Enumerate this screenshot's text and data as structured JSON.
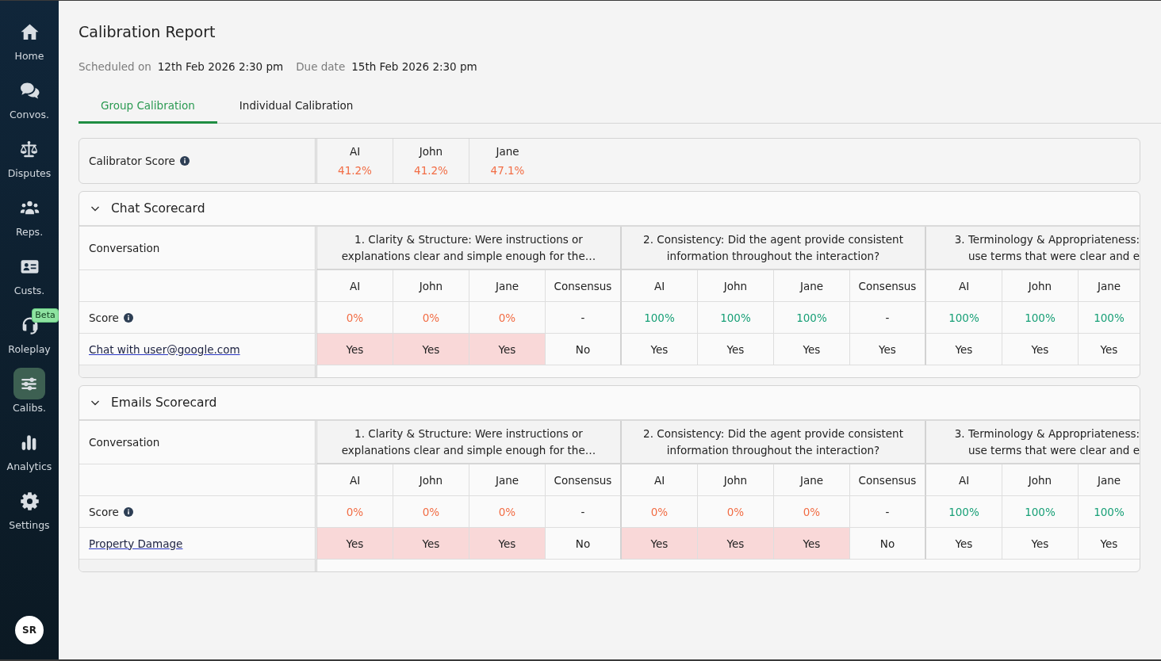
{
  "sidebar": {
    "items": [
      {
        "label": "Home",
        "selected": false
      },
      {
        "label": "Convos.",
        "selected": false
      },
      {
        "label": "Disputes",
        "selected": false
      },
      {
        "label": "Reps.",
        "selected": false
      },
      {
        "label": "Custs.",
        "selected": false
      },
      {
        "label": "Roleplay",
        "selected": false,
        "badge": "Beta"
      },
      {
        "label": "Calibs.",
        "selected": true
      },
      {
        "label": "Analytics",
        "selected": false
      },
      {
        "label": "Settings",
        "selected": false
      }
    ],
    "avatar": "SR"
  },
  "header": {
    "title": "Calibration Report",
    "meta": [
      {
        "label": "Scheduled on",
        "value": "12th Feb 2026 2:30 pm"
      },
      {
        "label": "Due date",
        "value": "15th Feb 2026 2:30 pm"
      }
    ]
  },
  "tabs": [
    {
      "label": "Group Calibration",
      "selected": true
    },
    {
      "label": "Individual Calibration",
      "selected": false
    }
  ],
  "calibrator_score": {
    "label": "Calibrator Score",
    "calibrators": [
      {
        "name": "AI",
        "score": "41.2%",
        "color": "#f26d45"
      },
      {
        "name": "John",
        "score": "41.2%",
        "color": "#f26d45"
      },
      {
        "name": "Jane",
        "score": "47.1%",
        "color": "#f26d45"
      }
    ]
  },
  "scorecards": [
    {
      "title": "Chat Scorecard",
      "expanded": true,
      "row_header": "Conversation",
      "score_label": "Score",
      "conversation": "Chat with user@google.com",
      "questions": [
        {
          "lines": [
            "1. Clarity & Structure: Were instructions or",
            "explanations clear and simple enough for the…"
          ],
          "columns": [
            {
              "name": "AI",
              "score": "0%",
              "color": "#f26d45",
              "answer": "Yes",
              "highlighted": true
            },
            {
              "name": "John",
              "score": "0%",
              "color": "#f26d45",
              "answer": "Yes",
              "highlighted": true
            },
            {
              "name": "Jane",
              "score": "0%",
              "color": "#f26d45",
              "answer": "Yes",
              "highlighted": true
            },
            {
              "name": "Consensus",
              "score": "-",
              "answer": "No",
              "highlighted": false
            }
          ]
        },
        {
          "lines": [
            "2. Consistency: Did the agent provide consistent",
            "information throughout the interaction?"
          ],
          "columns": [
            {
              "name": "AI",
              "score": "100%",
              "color": "#18a077",
              "answer": "Yes",
              "highlighted": false
            },
            {
              "name": "John",
              "score": "100%",
              "color": "#18a077",
              "answer": "Yes",
              "highlighted": false
            },
            {
              "name": "Jane",
              "score": "100%",
              "color": "#18a077",
              "answer": "Yes",
              "highlighted": false
            },
            {
              "name": "Consensus",
              "score": "-",
              "answer": "Yes",
              "highlighted": false
            }
          ]
        },
        {
          "lines": [
            "3. Terminology & Appropriateness:",
            "use terms that were clear and e"
          ],
          "columns": [
            {
              "name": "AI",
              "score": "100%",
              "color": "#18a077",
              "answer": "Yes",
              "highlighted": false
            },
            {
              "name": "John",
              "score": "100%",
              "color": "#18a077",
              "answer": "Yes",
              "highlighted": false
            },
            {
              "name": "Jane",
              "score": "100%",
              "color": "#18a077",
              "answer": "Yes",
              "highlighted": false
            }
          ]
        }
      ]
    },
    {
      "title": "Emails Scorecard",
      "expanded": true,
      "row_header": "Conversation",
      "score_label": "Score",
      "conversation": "Property Damage",
      "questions": [
        {
          "lines": [
            "1. Clarity & Structure: Were instructions or",
            "explanations clear and simple enough for the…"
          ],
          "columns": [
            {
              "name": "AI",
              "score": "0%",
              "color": "#f26d45",
              "answer": "Yes",
              "highlighted": true
            },
            {
              "name": "John",
              "score": "0%",
              "color": "#f26d45",
              "answer": "Yes",
              "highlighted": true
            },
            {
              "name": "Jane",
              "score": "0%",
              "color": "#f26d45",
              "answer": "Yes",
              "highlighted": true
            },
            {
              "name": "Consensus",
              "score": "-",
              "answer": "No",
              "highlighted": false
            }
          ]
        },
        {
          "lines": [
            "2. Consistency: Did the agent provide consistent",
            "information throughout the interaction?"
          ],
          "columns": [
            {
              "name": "AI",
              "score": "0%",
              "color": "#f26d45",
              "answer": "Yes",
              "highlighted": true
            },
            {
              "name": "John",
              "score": "0%",
              "color": "#f26d45",
              "answer": "Yes",
              "highlighted": true
            },
            {
              "name": "Jane",
              "score": "0%",
              "color": "#f26d45",
              "answer": "Yes",
              "highlighted": true
            },
            {
              "name": "Consensus",
              "score": "-",
              "answer": "No",
              "highlighted": false
            }
          ]
        },
        {
          "lines": [
            "3. Terminology & Appropriateness:",
            "use terms that were clear and e"
          ],
          "columns": [
            {
              "name": "AI",
              "score": "100%",
              "color": "#18a077",
              "answer": "Yes",
              "highlighted": false
            },
            {
              "name": "John",
              "score": "100%",
              "color": "#18a077",
              "answer": "Yes",
              "highlighted": false
            },
            {
              "name": "Jane",
              "score": "100%",
              "color": "#18a077",
              "answer": "Yes",
              "highlighted": false
            }
          ]
        }
      ]
    }
  ]
}
